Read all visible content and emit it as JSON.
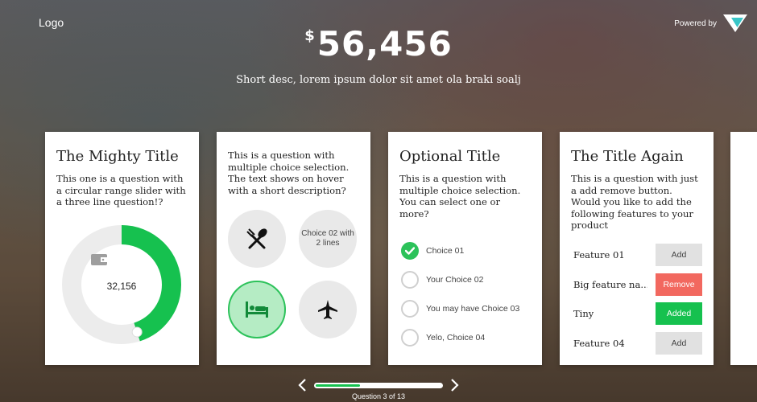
{
  "header": {
    "logo": "Logo",
    "powered_by": "Powered by",
    "currency": "$",
    "amount": "56,456",
    "description": "Short desc, lorem ipsum dolor sit amet ola braki soalj"
  },
  "cards": [
    {
      "title": "The Mighty Title",
      "question": "This one is a question with a circular range slider with a three line question!?",
      "slider_value": "32,156",
      "slider_fraction": 0.45,
      "icon": "wallet-icon"
    },
    {
      "question": "This is a question with multiple choice selection. The text shows on hover with a short description?",
      "choices": [
        {
          "icon": "restaurant-icon",
          "label": "",
          "selected": false
        },
        {
          "icon": "",
          "label": "Choice 02 with 2 lines",
          "selected": false
        },
        {
          "icon": "bed-icon",
          "label": "",
          "selected": true
        },
        {
          "icon": "airplane-icon",
          "label": "",
          "selected": false
        }
      ]
    },
    {
      "title": "Optional Title",
      "question": "This is a question with multiple choice selection. You can select one or more?",
      "options": [
        {
          "label": "Choice 01",
          "checked": true
        },
        {
          "label": "Your Choice 02",
          "checked": false
        },
        {
          "label": "You may have Choice 03",
          "checked": false
        },
        {
          "label": "Yelo, Choice 04",
          "checked": false
        }
      ]
    },
    {
      "title": "The Title Again",
      "question": "This is a question with just a add remove button. Would you like to add the following features to your product",
      "features": [
        {
          "name": "Feature 01",
          "button": "Add",
          "state": "add"
        },
        {
          "name": "Big feature na...",
          "button": "Remove",
          "state": "remove"
        },
        {
          "name": "Tiny",
          "button": "Added",
          "state": "added"
        },
        {
          "name": "Feature 04",
          "button": "Add",
          "state": "add"
        }
      ]
    }
  ],
  "pager": {
    "label": "Question 3 of 13",
    "progress_fraction": 0.35
  },
  "colors": {
    "accent_green": "#16c14f",
    "remove_red": "#f2685f",
    "button_gray": "#e1e1e1"
  }
}
